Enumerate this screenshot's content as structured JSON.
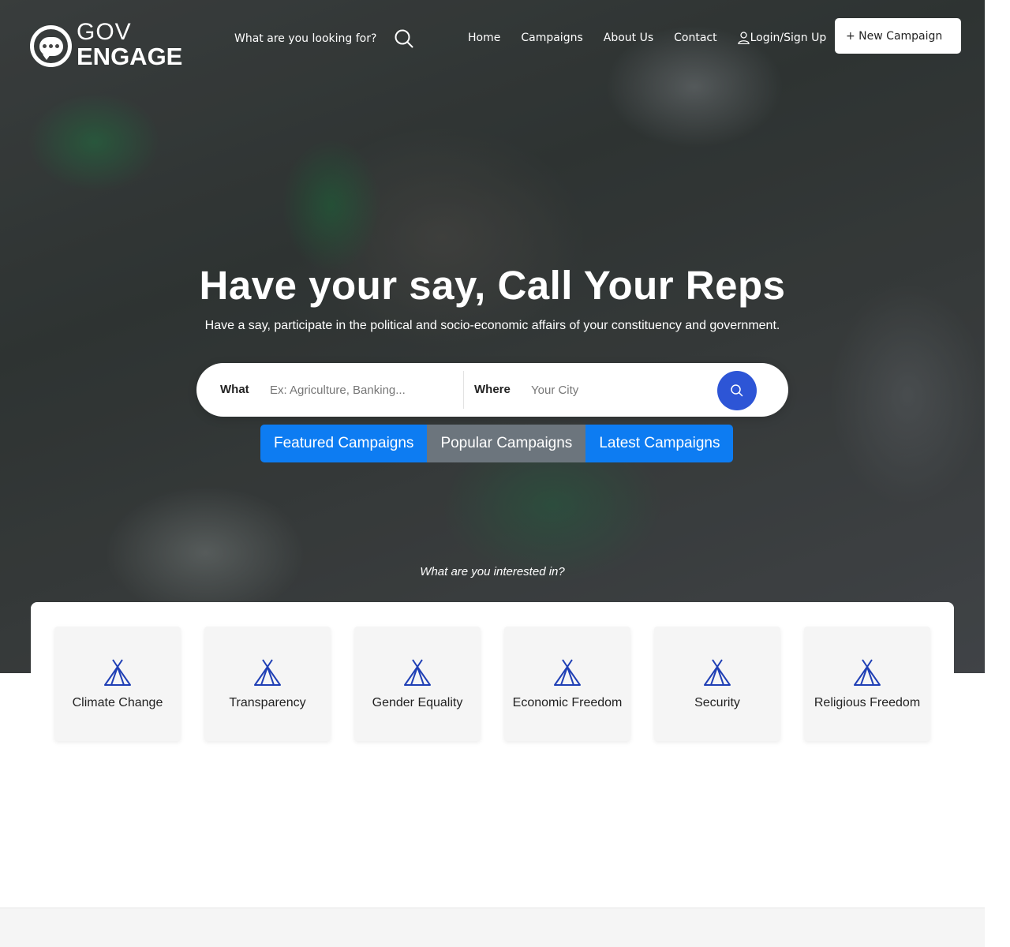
{
  "header": {
    "logo": {
      "top": "GOV",
      "bottom": "ENGAGE"
    },
    "search_prompt": "What are you looking for?",
    "nav": [
      {
        "label": "Home"
      },
      {
        "label": "Campaigns"
      },
      {
        "label": "About Us"
      },
      {
        "label": "Contact"
      },
      {
        "label": "Login/Sign Up",
        "icon": "user-icon"
      }
    ],
    "new_campaign_label": "+ New Campaign"
  },
  "hero": {
    "title": "Have your say, Call Your Reps",
    "subtitle": "Have a say, participate in the political and socio-economic affairs of your constituency and government.",
    "search": {
      "what_label": "What",
      "what_placeholder": "Ex: Agriculture, Banking...",
      "where_label": "Where",
      "where_placeholder": "Your City",
      "button_icon": "search-icon"
    },
    "tabs": [
      {
        "label": "Featured Campaigns",
        "active_color": "#0d7cf2"
      },
      {
        "label": "Popular Campaigns",
        "active_color": "#6c757d"
      },
      {
        "label": "Latest Campaigns",
        "active_color": "#0d7cf2"
      }
    ],
    "interest_prompt": "What are you interested in?"
  },
  "categories": [
    {
      "label": "Climate Change",
      "icon": "tent-icon"
    },
    {
      "label": "Transparency",
      "icon": "tent-icon"
    },
    {
      "label": "Gender Equality",
      "icon": "tent-icon"
    },
    {
      "label": "Economic Freedom",
      "icon": "tent-icon"
    },
    {
      "label": "Security",
      "icon": "tent-icon"
    },
    {
      "label": "Religious Freedom",
      "icon": "tent-icon"
    }
  ],
  "colors": {
    "accent": "#2d55d6",
    "tab_blue": "#0d7cf2",
    "tab_grey": "#6c757d",
    "icon_blue": "#1f3fb5"
  }
}
